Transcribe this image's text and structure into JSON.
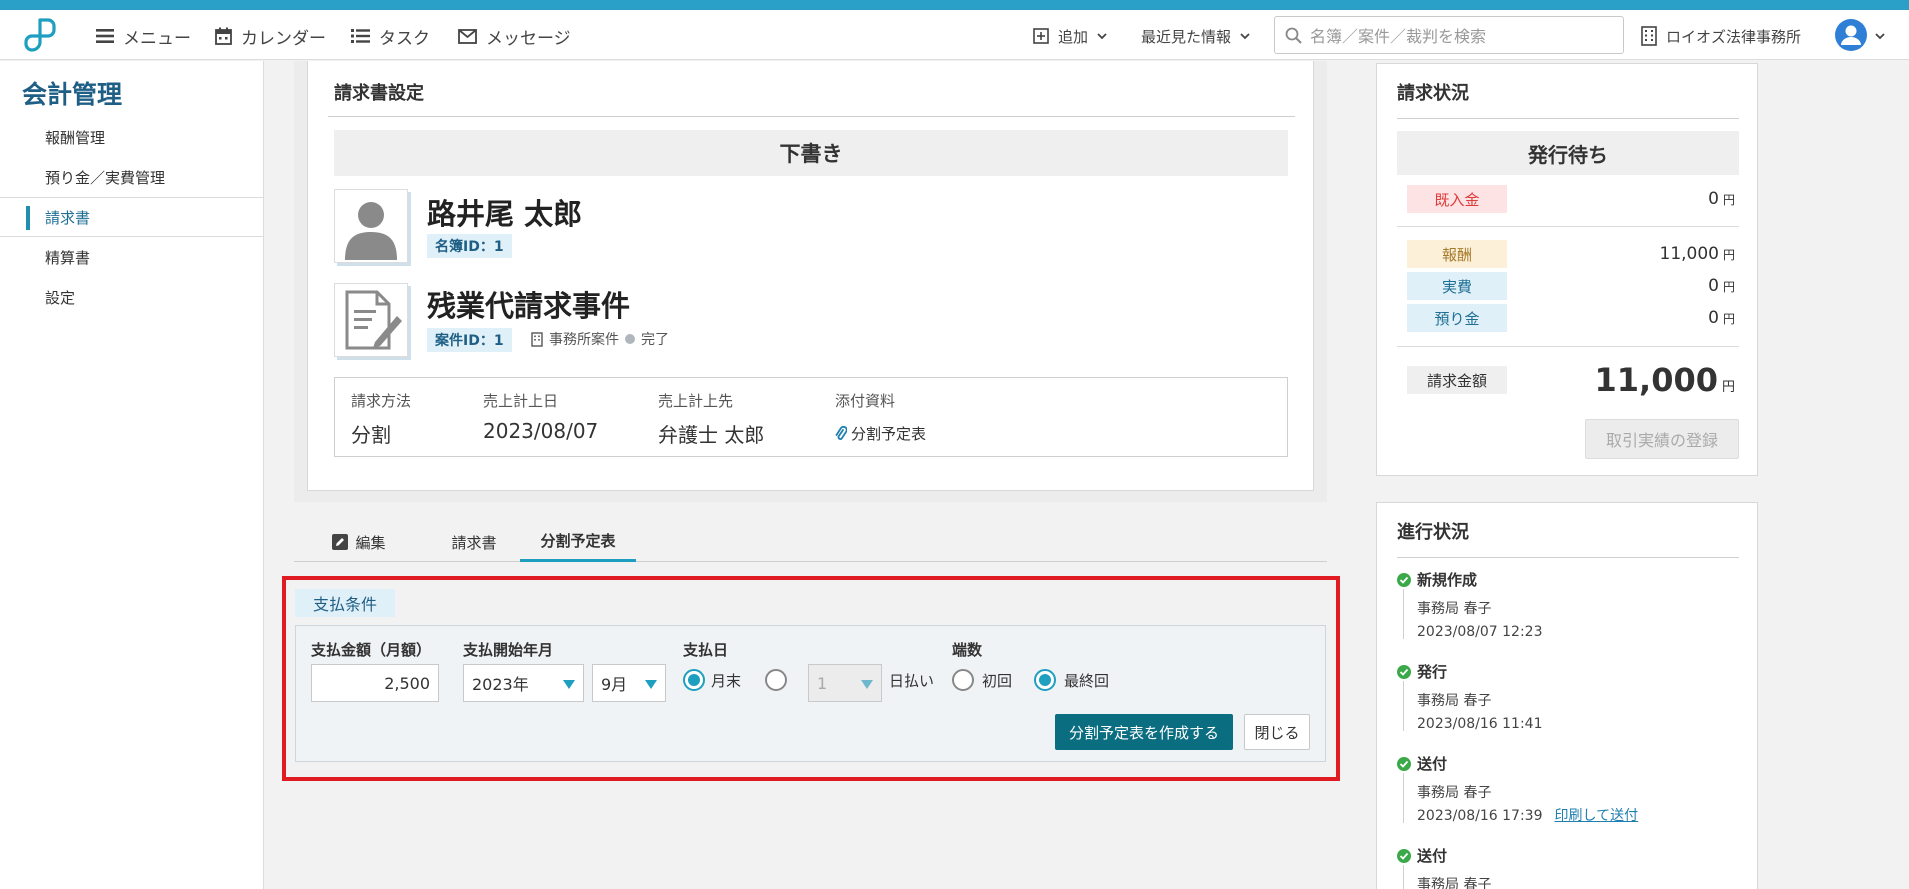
{
  "topnav": {
    "menu": "メニュー",
    "calendar": "カレンダー",
    "task": "タスク",
    "message": "メッセージ",
    "add": "追加",
    "recent": "最近見た情報",
    "search_placeholder": "名簿／案件／裁判を検索",
    "office": "ロイオズ法律事務所"
  },
  "sidebar": {
    "title": "会計管理",
    "items": [
      {
        "label": "報酬管理"
      },
      {
        "label": "預り金／実費管理"
      },
      {
        "label": "請求書"
      },
      {
        "label": "精算書"
      },
      {
        "label": "設定"
      }
    ]
  },
  "invoice": {
    "title": "請求書設定",
    "status": "下書き",
    "person_name": "路井尾 太郎",
    "person_id": "名簿ID：1",
    "case_name": "残業代請求事件",
    "case_id": "案件ID：1",
    "case_type": "事務所案件",
    "case_status": "完了",
    "info": {
      "method_label": "請求方法",
      "method_value": "分割",
      "date_label": "売上計上日",
      "date_value": "2023/08/07",
      "target_label": "売上計上先",
      "target_value": "弁護士 太郎",
      "attach_label": "添付資料",
      "attach_value": "分割予定表"
    }
  },
  "tabs": [
    {
      "label": "編集"
    },
    {
      "label": "請求書"
    },
    {
      "label": "分割予定表"
    }
  ],
  "payment": {
    "tag": "支払条件",
    "amount_label": "支払金額（月額）",
    "amount_value": "2,500",
    "start_label": "支払開始年月",
    "start_year": "2023年",
    "start_month": "9月",
    "payday_label": "支払日",
    "month_end": "月末",
    "day_value": "1",
    "day_suffix": "日払い",
    "rounding_label": "端数",
    "first": "初回",
    "last": "最終回",
    "create_button": "分割予定表を作成する",
    "close_button": "閉じる"
  },
  "billing_status": {
    "title": "請求状況",
    "status": "発行待ち",
    "rows": [
      {
        "label": "既入金",
        "value": "0",
        "unit": "円",
        "color": "#e03b3b",
        "bg": "#fde3e3"
      },
      {
        "label": "報酬",
        "value": "11,000",
        "unit": "円",
        "color": "#a77a2a",
        "bg": "#fdf0d9"
      },
      {
        "label": "実費",
        "value": "0",
        "unit": "円",
        "color": "#1f6f95",
        "bg": "#dff0f8"
      },
      {
        "label": "預り金",
        "value": "0",
        "unit": "円",
        "color": "#1f6f95",
        "bg": "#dff0f8"
      }
    ],
    "total_label": "請求金額",
    "total_value": "11,000",
    "total_unit": "円",
    "register_button": "取引実績の登録"
  },
  "progress": {
    "title": "進行状況",
    "steps": [
      {
        "title": "新規作成",
        "user": "事務局 春子",
        "time": "2023/08/07 12:23",
        "link": ""
      },
      {
        "title": "発行",
        "user": "事務局 春子",
        "time": "2023/08/16 11:41",
        "link": ""
      },
      {
        "title": "送付",
        "user": "事務局 春子",
        "time": "2023/08/16 17:39",
        "link": "印刷して送付"
      },
      {
        "title": "送付",
        "user": "事務局 春子",
        "time": "",
        "link": ""
      }
    ]
  }
}
